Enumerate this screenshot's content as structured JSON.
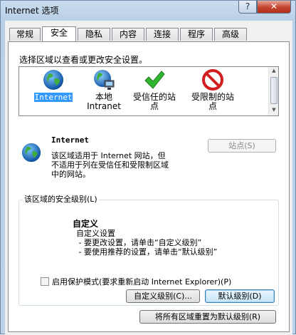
{
  "window": {
    "title": "Internet 选项",
    "help_glyph": "?",
    "close_glyph": "✕"
  },
  "tabs": [
    {
      "label": "常规",
      "active": false
    },
    {
      "label": "安全",
      "active": true
    },
    {
      "label": "隐私",
      "active": false
    },
    {
      "label": "内容",
      "active": false
    },
    {
      "label": "连接",
      "active": false
    },
    {
      "label": "程序",
      "active": false
    },
    {
      "label": "高级",
      "active": false
    }
  ],
  "security": {
    "select_zone_label": "选择区域以查看或更改安全设置。",
    "zones": [
      {
        "label": "Internet",
        "icon": "globe-icon",
        "selected": true
      },
      {
        "label": "本地\nIntranet",
        "icon": "intranet-globe-icon",
        "selected": false
      },
      {
        "label": "受信任的站\n点",
        "icon": "check-icon",
        "selected": false
      },
      {
        "label": "受限制的站\n点",
        "icon": "forbidden-icon",
        "selected": false
      }
    ],
    "zone_name": "Internet",
    "zone_description": "该区域适用于 Internet 网站，但\n不适用于列在受信任和受限制区域\n中的网站。",
    "sites_button": "站点(S)",
    "level_group_label": "该区域的安全级别(L)",
    "level_title": "自定义",
    "level_description": "自定义设置\n - 要更改设置，请单击“自定义级别”\n - 要使用推荐的设置，请单击“默认级别”",
    "protected_mode_label": "启用保护模式(要求重新启动 Internet Explorer)(P)",
    "protected_mode_checked": false,
    "custom_level_button": "自定义级别(C)...",
    "default_level_button": "默认级别(D)",
    "reset_all_button": "将所有区域重置为默认级别(R)"
  }
}
